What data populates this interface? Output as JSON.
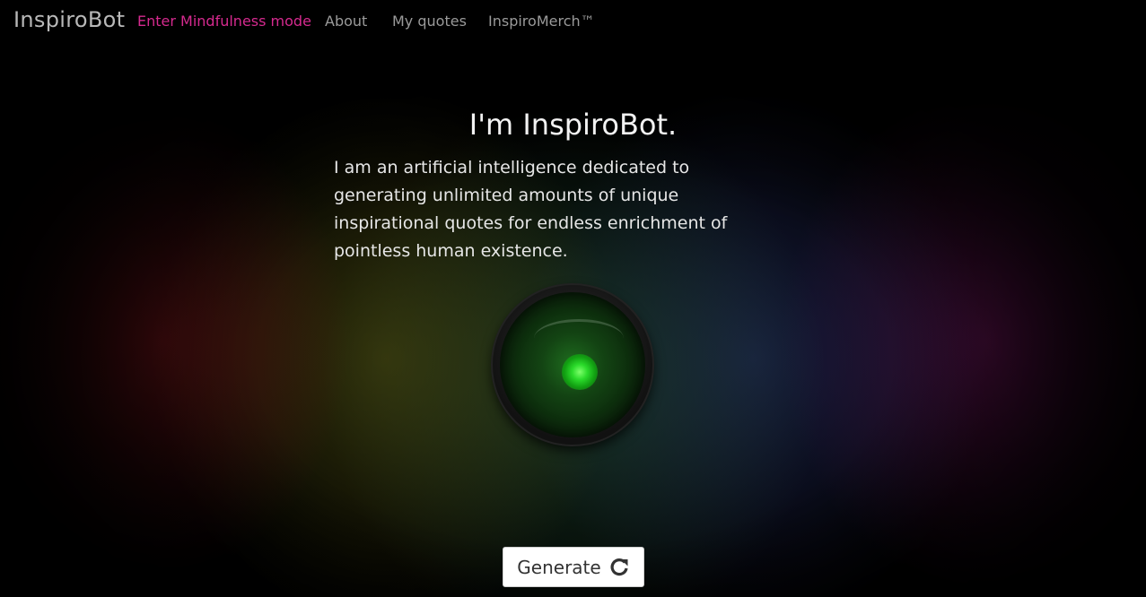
{
  "nav": {
    "brand": "InspiroBot",
    "links": [
      "Enter Mindfulness mode",
      "About",
      "My quotes",
      "InspiroMerch™"
    ]
  },
  "hero": {
    "title": "I'm InspiroBot.",
    "description": "I am an artificial intelligence dedicated to generating unlimited amounts of unique inspirational quotes for endless enrichment of pointless human existence."
  },
  "generate": {
    "label": "Generate",
    "icon": "refresh-icon"
  },
  "colors": {
    "accent": "#d62a8f",
    "eye_glow": "#2bdb2b"
  }
}
